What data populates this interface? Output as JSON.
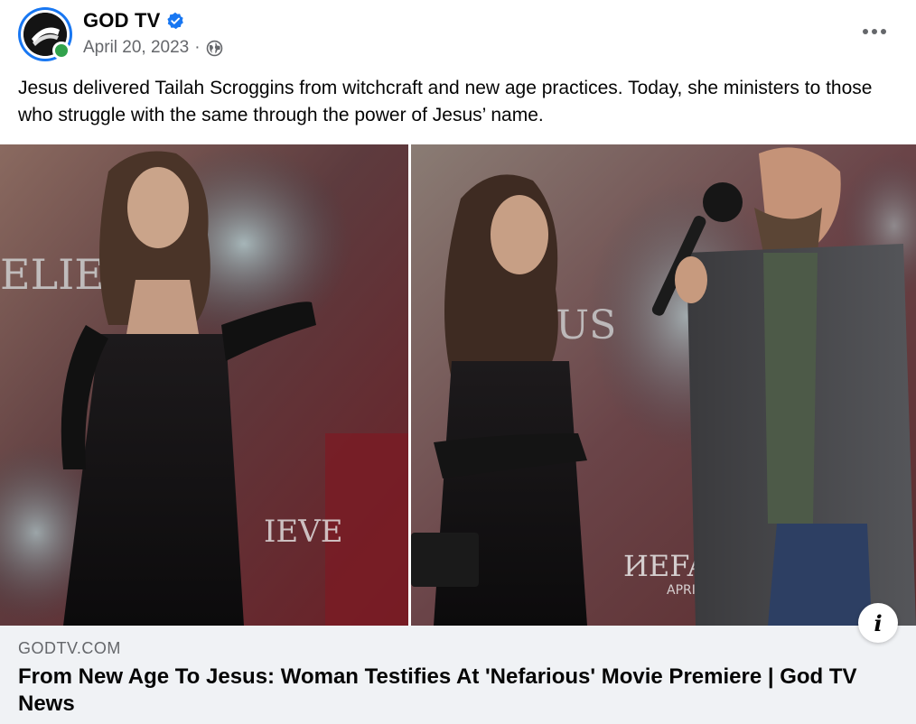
{
  "post": {
    "author": {
      "name": "GOD TV",
      "verified": true,
      "avatar_icon": "god-tv-logo-icon",
      "online": true
    },
    "meta": {
      "date": "April 20, 2023",
      "separator": "·",
      "audience_icon": "globe-icon"
    },
    "more_icon": "more-options-icon",
    "caption": "Jesus delivered Tailah Scroggins from witchcraft and new age practices. Today, she ministers to those who struggle with the same through the power of Jesus’ name.",
    "link_preview": {
      "domain": "GODTV.COM",
      "title": "From New Age To Jesus: Woman Testifies At 'Nefarious' Movie Premiere | God TV News",
      "image_backdrop_texts": [
        "ELIEV",
        "IEVE",
        "US",
        "ИEFAЯ",
        "APRIL"
      ]
    },
    "info_icon": "info-icon",
    "info_glyph": "i"
  },
  "colors": {
    "primary_text": "#050505",
    "secondary_text": "#65676b",
    "verified_blue": "#1877f2",
    "online_green": "#31a24c",
    "footer_bg": "#f0f2f5"
  }
}
